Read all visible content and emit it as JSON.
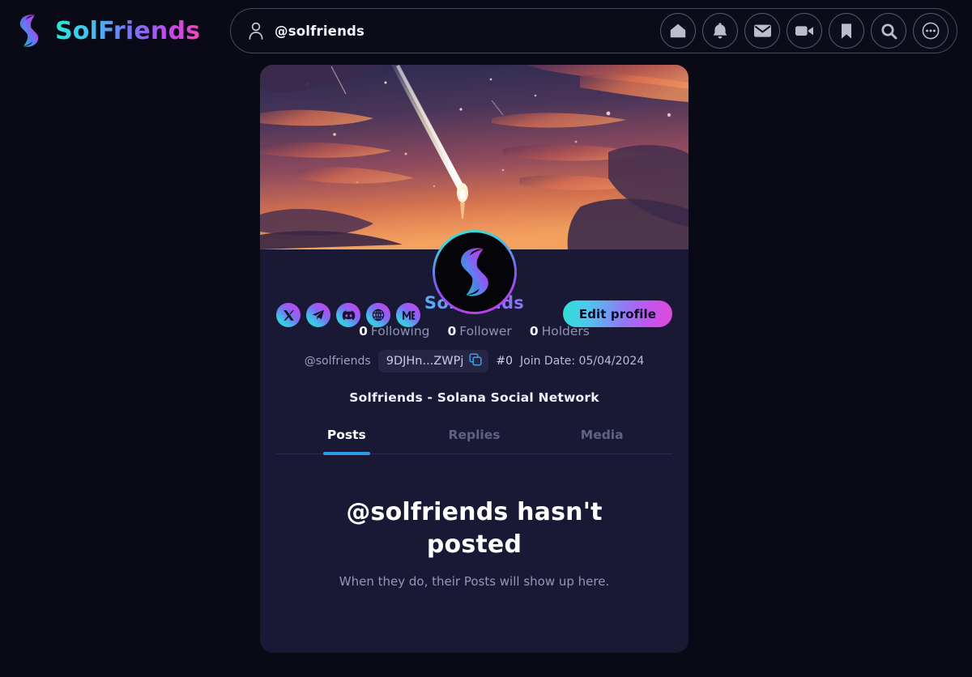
{
  "header": {
    "brand_name": "SolFriends",
    "brand_logo_icon": "solfriends-logo-icon",
    "user_icon": "person-icon",
    "user_handle": "@solfriends",
    "nav_icons": [
      {
        "name": "home-icon",
        "label": "Home"
      },
      {
        "name": "bell-icon",
        "label": "Notifications"
      },
      {
        "name": "envelope-icon",
        "label": "Messages"
      },
      {
        "name": "video-camera-icon",
        "label": "Video"
      },
      {
        "name": "bookmark-icon",
        "label": "Bookmarks"
      },
      {
        "name": "search-icon",
        "label": "Search"
      },
      {
        "name": "more-dots-icon",
        "label": "More"
      }
    ]
  },
  "profile": {
    "avatar_icon": "solfriends-avatar-icon",
    "banner_alt": "Anime sunset sky with comet streaking toward horizon",
    "socials": [
      {
        "name": "x-twitter-icon",
        "label": "X"
      },
      {
        "name": "telegram-icon",
        "label": "Telegram"
      },
      {
        "name": "discord-icon",
        "label": "Discord"
      },
      {
        "name": "globe-website-icon",
        "label": "Website"
      },
      {
        "name": "magic-eden-icon",
        "label": "Magic Eden"
      }
    ],
    "edit_button_label": "Edit profile",
    "display_name": "Solfriends",
    "stats": [
      {
        "count": "0",
        "label": "Following"
      },
      {
        "count": "0",
        "label": "Follower"
      },
      {
        "count": "0",
        "label": "Holders"
      }
    ],
    "handle": "@solfriends",
    "wallet_address": "9DJHn...ZWPj",
    "copy_icon": "copy-icon",
    "token_id": "#0",
    "join_date": "Join Date: 05/04/2024",
    "bio": "Solfriends - Solana Social Network"
  },
  "tabs": [
    {
      "label": "Posts",
      "active": true
    },
    {
      "label": "Replies",
      "active": false
    },
    {
      "label": "Media",
      "active": false
    }
  ],
  "empty_state": {
    "title": "@solfriends hasn't posted",
    "subtitle": "When they do, their Posts will show up here."
  },
  "colors": {
    "page_background": "#0a0a16",
    "card_background": "#1a1935",
    "accent_cyan": "#2ee6d6",
    "accent_magenta": "#e04ad8",
    "tab_underline": "#2f9ae8",
    "muted_text": "#8e93ad"
  }
}
